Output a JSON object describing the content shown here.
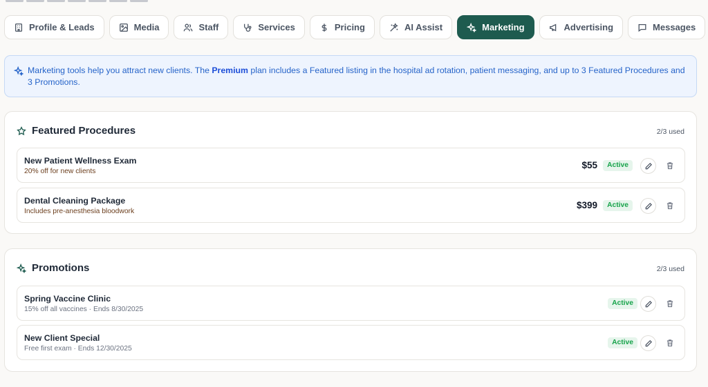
{
  "tabs": [
    {
      "label": "Profile & Leads",
      "icon": "building-icon",
      "active": false
    },
    {
      "label": "Media",
      "icon": "image-icon",
      "active": false
    },
    {
      "label": "Staff",
      "icon": "users-icon",
      "active": false
    },
    {
      "label": "Services",
      "icon": "stethoscope-icon",
      "active": false
    },
    {
      "label": "Pricing",
      "icon": "dollar-icon",
      "active": false
    },
    {
      "label": "AI Assist",
      "icon": "wand-icon",
      "active": false
    },
    {
      "label": "Marketing",
      "icon": "sparkles-icon",
      "active": true
    },
    {
      "label": "Advertising",
      "icon": "megaphone-icon",
      "active": false
    },
    {
      "label": "Messages",
      "icon": "message-icon",
      "active": false
    }
  ],
  "info": {
    "pre": "Marketing tools help you attract new clients. The ",
    "plan": "Premium",
    "post": " plan includes a Featured listing in the hospital ad rotation, patient messaging, and up to 3 Featured Procedures and 3 Promotions."
  },
  "featured": {
    "title": "Featured Procedures",
    "used": "2/3 used",
    "items": [
      {
        "title": "New Patient Wellness Exam",
        "subtitle": "20% off for new clients",
        "price": "$55",
        "status": "Active"
      },
      {
        "title": "Dental Cleaning Package",
        "subtitle": "Includes pre-anesthesia bloodwork",
        "price": "$399",
        "status": "Active"
      }
    ]
  },
  "promotions": {
    "title": "Promotions",
    "used": "2/3 used",
    "items": [
      {
        "title": "Spring Vaccine Clinic",
        "subtitle": "15% off all vaccines · Ends 8/30/2025",
        "status": "Active"
      },
      {
        "title": "New Client Special",
        "subtitle": "Free first exam · Ends 12/30/2025",
        "status": "Active"
      }
    ]
  },
  "colors": {
    "brand": "#1e5b4f",
    "info_text": "#2563c9",
    "active_badge_bg": "#e6f5ec",
    "active_badge_text": "#16a34a"
  }
}
